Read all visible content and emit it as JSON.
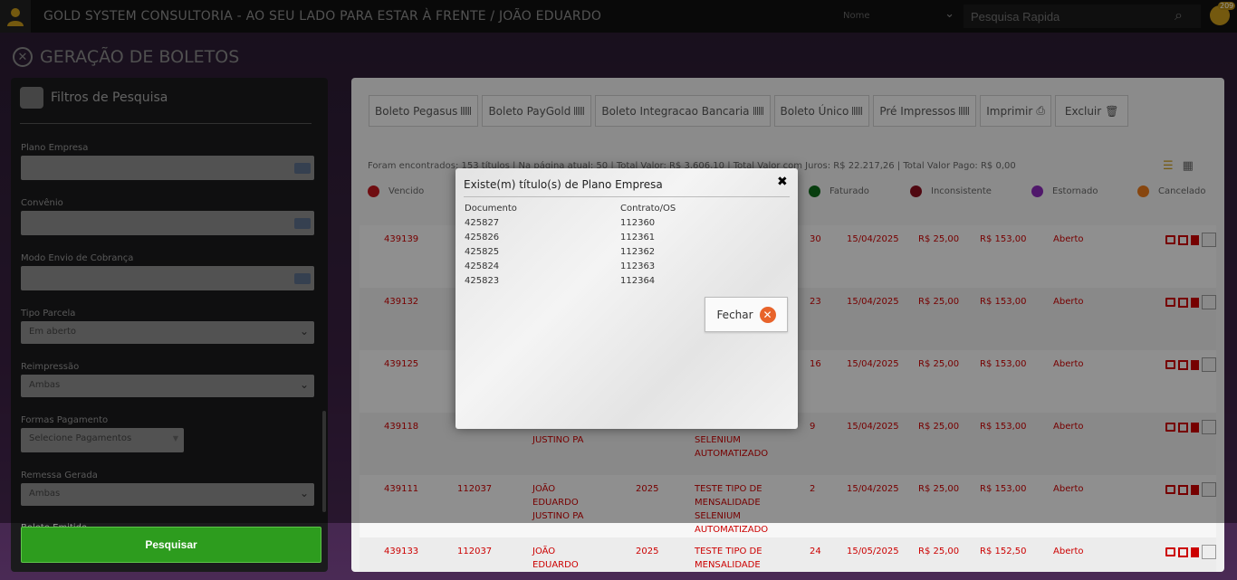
{
  "topbar": {
    "title": "GOLD SYSTEM CONSULTORIA - AO SEU LADO PARA ESTAR À FRENTE / JOÃO EDUARDO",
    "search_type": "Nome",
    "search_placeholder": "Pesquisa Rapida",
    "notification_count": "209"
  },
  "page": {
    "title": "GERAÇÃO DE BOLETOS"
  },
  "filters": {
    "title": "Filtros de Pesquisa",
    "plano_empresa_label": "Plano Empresa",
    "convenio_label": "Convênio",
    "modo_envio_label": "Modo Envio de Cobrança",
    "tipo_parcela_label": "Tipo Parcela",
    "tipo_parcela_value": "Em aberto",
    "reimpressao_label": "Reimpressão",
    "reimpressao_value": "Ambas",
    "formas_pagamento_label": "Formas Pagamento",
    "formas_pagamento_value": "Selecione Pagamentos",
    "remessa_gerada_label": "Remessa Gerada",
    "remessa_gerada_value": "Ambas",
    "cut_label": "Boleto Emitido",
    "search_button": "Pesquisar"
  },
  "toolbar": {
    "buttons": [
      "Boleto Pegasus",
      "Boleto PayGold",
      "Boleto Integracao Bancaria",
      "Boleto Único",
      "Pré Impressos",
      "Imprimir",
      "Excluir"
    ]
  },
  "summary": "Foram encontrados: 153 títulos  |  Na página atual: 50  |  Total Valor: R$ 3.606,10  |  Total Valor com Juros: R$ 22.217,26  |  Total Valor Pago: R$ 0,00",
  "legend": [
    {
      "label": "Vencido",
      "color": "#c0181e"
    },
    {
      "label": "Faturado",
      "color": "#0e6b1a"
    },
    {
      "label": "Inconsistente",
      "color": "#8a0f1e"
    },
    {
      "label": "Estornado",
      "color": "#8a2ab8"
    },
    {
      "label": "Cancelado",
      "color": "#e8791a"
    }
  ],
  "rows": [
    {
      "id": "439139",
      "contrato": "",
      "cliente": "",
      "ano": "",
      "produto": "",
      "parcela": "30",
      "vencimento": "15/04/2025",
      "valor": "R$ 25,00",
      "total": "R$ 153,00",
      "status": "Aberto"
    },
    {
      "id": "439132",
      "contrato": "",
      "cliente": "",
      "ano": "",
      "produto": "",
      "parcela": "23",
      "vencimento": "15/04/2025",
      "valor": "R$ 25,00",
      "total": "R$ 153,00",
      "status": "Aberto"
    },
    {
      "id": "439125",
      "contrato": "",
      "cliente": "",
      "ano": "",
      "produto": "",
      "parcela": "16",
      "vencimento": "15/04/2025",
      "valor": "R$ 25,00",
      "total": "R$ 153,00",
      "status": "Aberto"
    },
    {
      "id": "439118",
      "contrato": "",
      "cliente": "EDUARDO\nJUSTINO PA",
      "ano": "",
      "produto": "MENSALIDADE\nSELENIUM\nAUTOMATIZADO",
      "parcela": "9",
      "vencimento": "15/04/2025",
      "valor": "R$ 25,00",
      "total": "R$ 153,00",
      "status": "Aberto"
    },
    {
      "id": "439111",
      "contrato": "112037",
      "cliente": "JOÃO\nEDUARDO\nJUSTINO PA",
      "ano": "2025",
      "produto": "TESTE TIPO DE\nMENSALIDADE\nSELENIUM\nAUTOMATIZADO",
      "parcela": "2",
      "vencimento": "15/04/2025",
      "valor": "R$ 25,00",
      "total": "R$ 153,00",
      "status": "Aberto"
    },
    {
      "id": "439133",
      "contrato": "112037",
      "cliente": "JOÃO\nEDUARDO",
      "ano": "2025",
      "produto": "TESTE TIPO DE\nMENSALIDADE",
      "parcela": "24",
      "vencimento": "15/05/2025",
      "valor": "R$ 25,00",
      "total": "R$ 152,50",
      "status": "Aberto"
    }
  ],
  "modal": {
    "title": "Existe(m) título(s) de Plano Empresa",
    "col_documento": "Documento",
    "col_contrato": "Contrato/OS",
    "items": [
      {
        "documento": "425827",
        "contrato": "112360"
      },
      {
        "documento": "425826",
        "contrato": "112361"
      },
      {
        "documento": "425825",
        "contrato": "112362"
      },
      {
        "documento": "425824",
        "contrato": "112363"
      },
      {
        "documento": "425823",
        "contrato": "112364"
      }
    ],
    "close_button": "Fechar"
  }
}
